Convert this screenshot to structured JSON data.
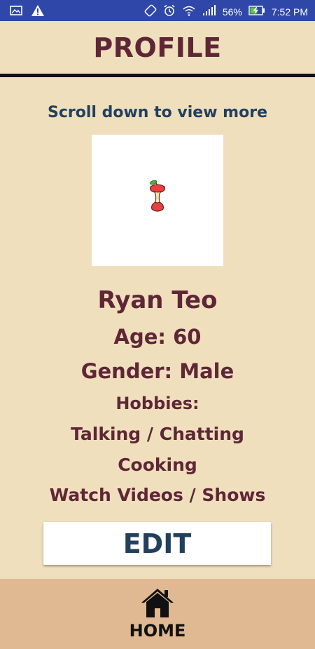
{
  "status_bar": {
    "battery": "56%",
    "time": "7:52 PM"
  },
  "header": {
    "title": "PROFILE"
  },
  "scroll_hint": "Scroll down to view more",
  "profile": {
    "name": "Ryan Teo",
    "age": "Age: 60",
    "gender": "Gender: Male",
    "hobbies_label": "Hobbies:",
    "hobbies": [
      "Talking / Chatting",
      "Cooking",
      "Watch Videos / Shows"
    ],
    "avatar_icon": "apple-core-icon"
  },
  "edit_button": {
    "label": "EDIT"
  },
  "nav": {
    "home_label": "HOME",
    "home_icon": "home-icon"
  },
  "colors": {
    "background": "#f0dfbc",
    "status_bar": "#2f47a8",
    "title_text": "#5e2636",
    "accent_text": "#22405e",
    "bottom_nav": "#e0b992"
  }
}
